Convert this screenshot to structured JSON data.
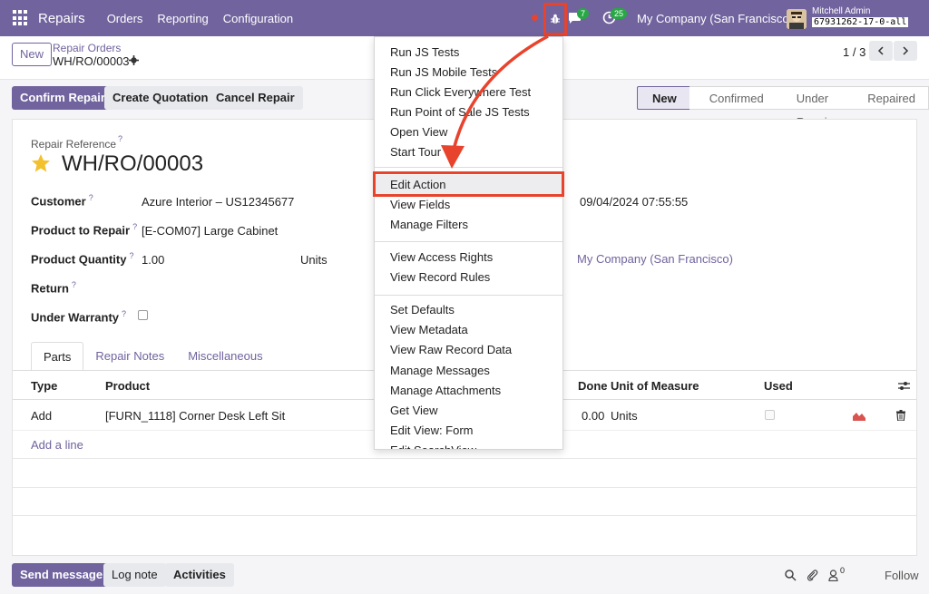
{
  "navbar": {
    "brand": "Repairs",
    "menus": [
      "Orders",
      "Reporting",
      "Configuration"
    ],
    "chat_count": "7",
    "activity_count": "25",
    "company": "My Company (San Francisco)",
    "user_name": "Mitchell Admin",
    "database": "67931262-17-0-all"
  },
  "control": {
    "new_label": "New",
    "breadcrumb_parent": "Repair Orders",
    "breadcrumb_current": "WH/RO/00003",
    "pager": "1 / 3"
  },
  "actions": {
    "confirm": "Confirm Repair",
    "quotation": "Create Quotation",
    "cancel": "Cancel Repair"
  },
  "statusbar": [
    "New",
    "Confirmed",
    "Under Repair",
    "Repaired"
  ],
  "form": {
    "reference_label": "Repair Reference",
    "reference_value": "WH/RO/00003",
    "customer_label": "Customer",
    "customer_value": "Azure Interior – US12345677",
    "product_label": "Product to Repair",
    "product_value": "[E-COM07] Large Cabinet",
    "qty_label": "Product Quantity",
    "qty_value": "1.00",
    "qty_unit": "Units",
    "return_label": "Return",
    "warranty_label": "Under Warranty",
    "date_value": "09/04/2024 07:55:55",
    "company_value": "My Company (San Francisco)"
  },
  "tabs": [
    "Parts",
    "Repair Notes",
    "Miscellaneous"
  ],
  "parts_table": {
    "headers": [
      "Type",
      "Product",
      "Done",
      "Unit of Measure",
      "Used"
    ],
    "rows": [
      {
        "type": "Add",
        "product": "[FURN_1118] Corner Desk Left Sit",
        "done": "0.00",
        "uom": "Units"
      }
    ],
    "add_line": "Add a line"
  },
  "chatter": {
    "send": "Send message",
    "log": "Log note",
    "activities": "Activities",
    "followers_count": "0",
    "follow": "Follow"
  },
  "debug_menu": {
    "group1": [
      "Run JS Tests",
      "Run JS Mobile Tests",
      "Run Click Everywhere Test",
      "Run Point of Sale JS Tests",
      "Open View",
      "Start Tour"
    ],
    "group2": [
      "Edit Action",
      "View Fields",
      "Manage Filters"
    ],
    "group3": [
      "View Access Rights",
      "View Record Rules"
    ],
    "group4": [
      "Set Defaults",
      "View Metadata",
      "View Raw Record Data",
      "Manage Messages",
      "Manage Attachments",
      "Get View",
      "Edit View: Form",
      "Edit SearchView"
    ]
  },
  "colors": {
    "brand": "#71639e",
    "highlight": "#e8432c",
    "badge": "#28a745"
  }
}
